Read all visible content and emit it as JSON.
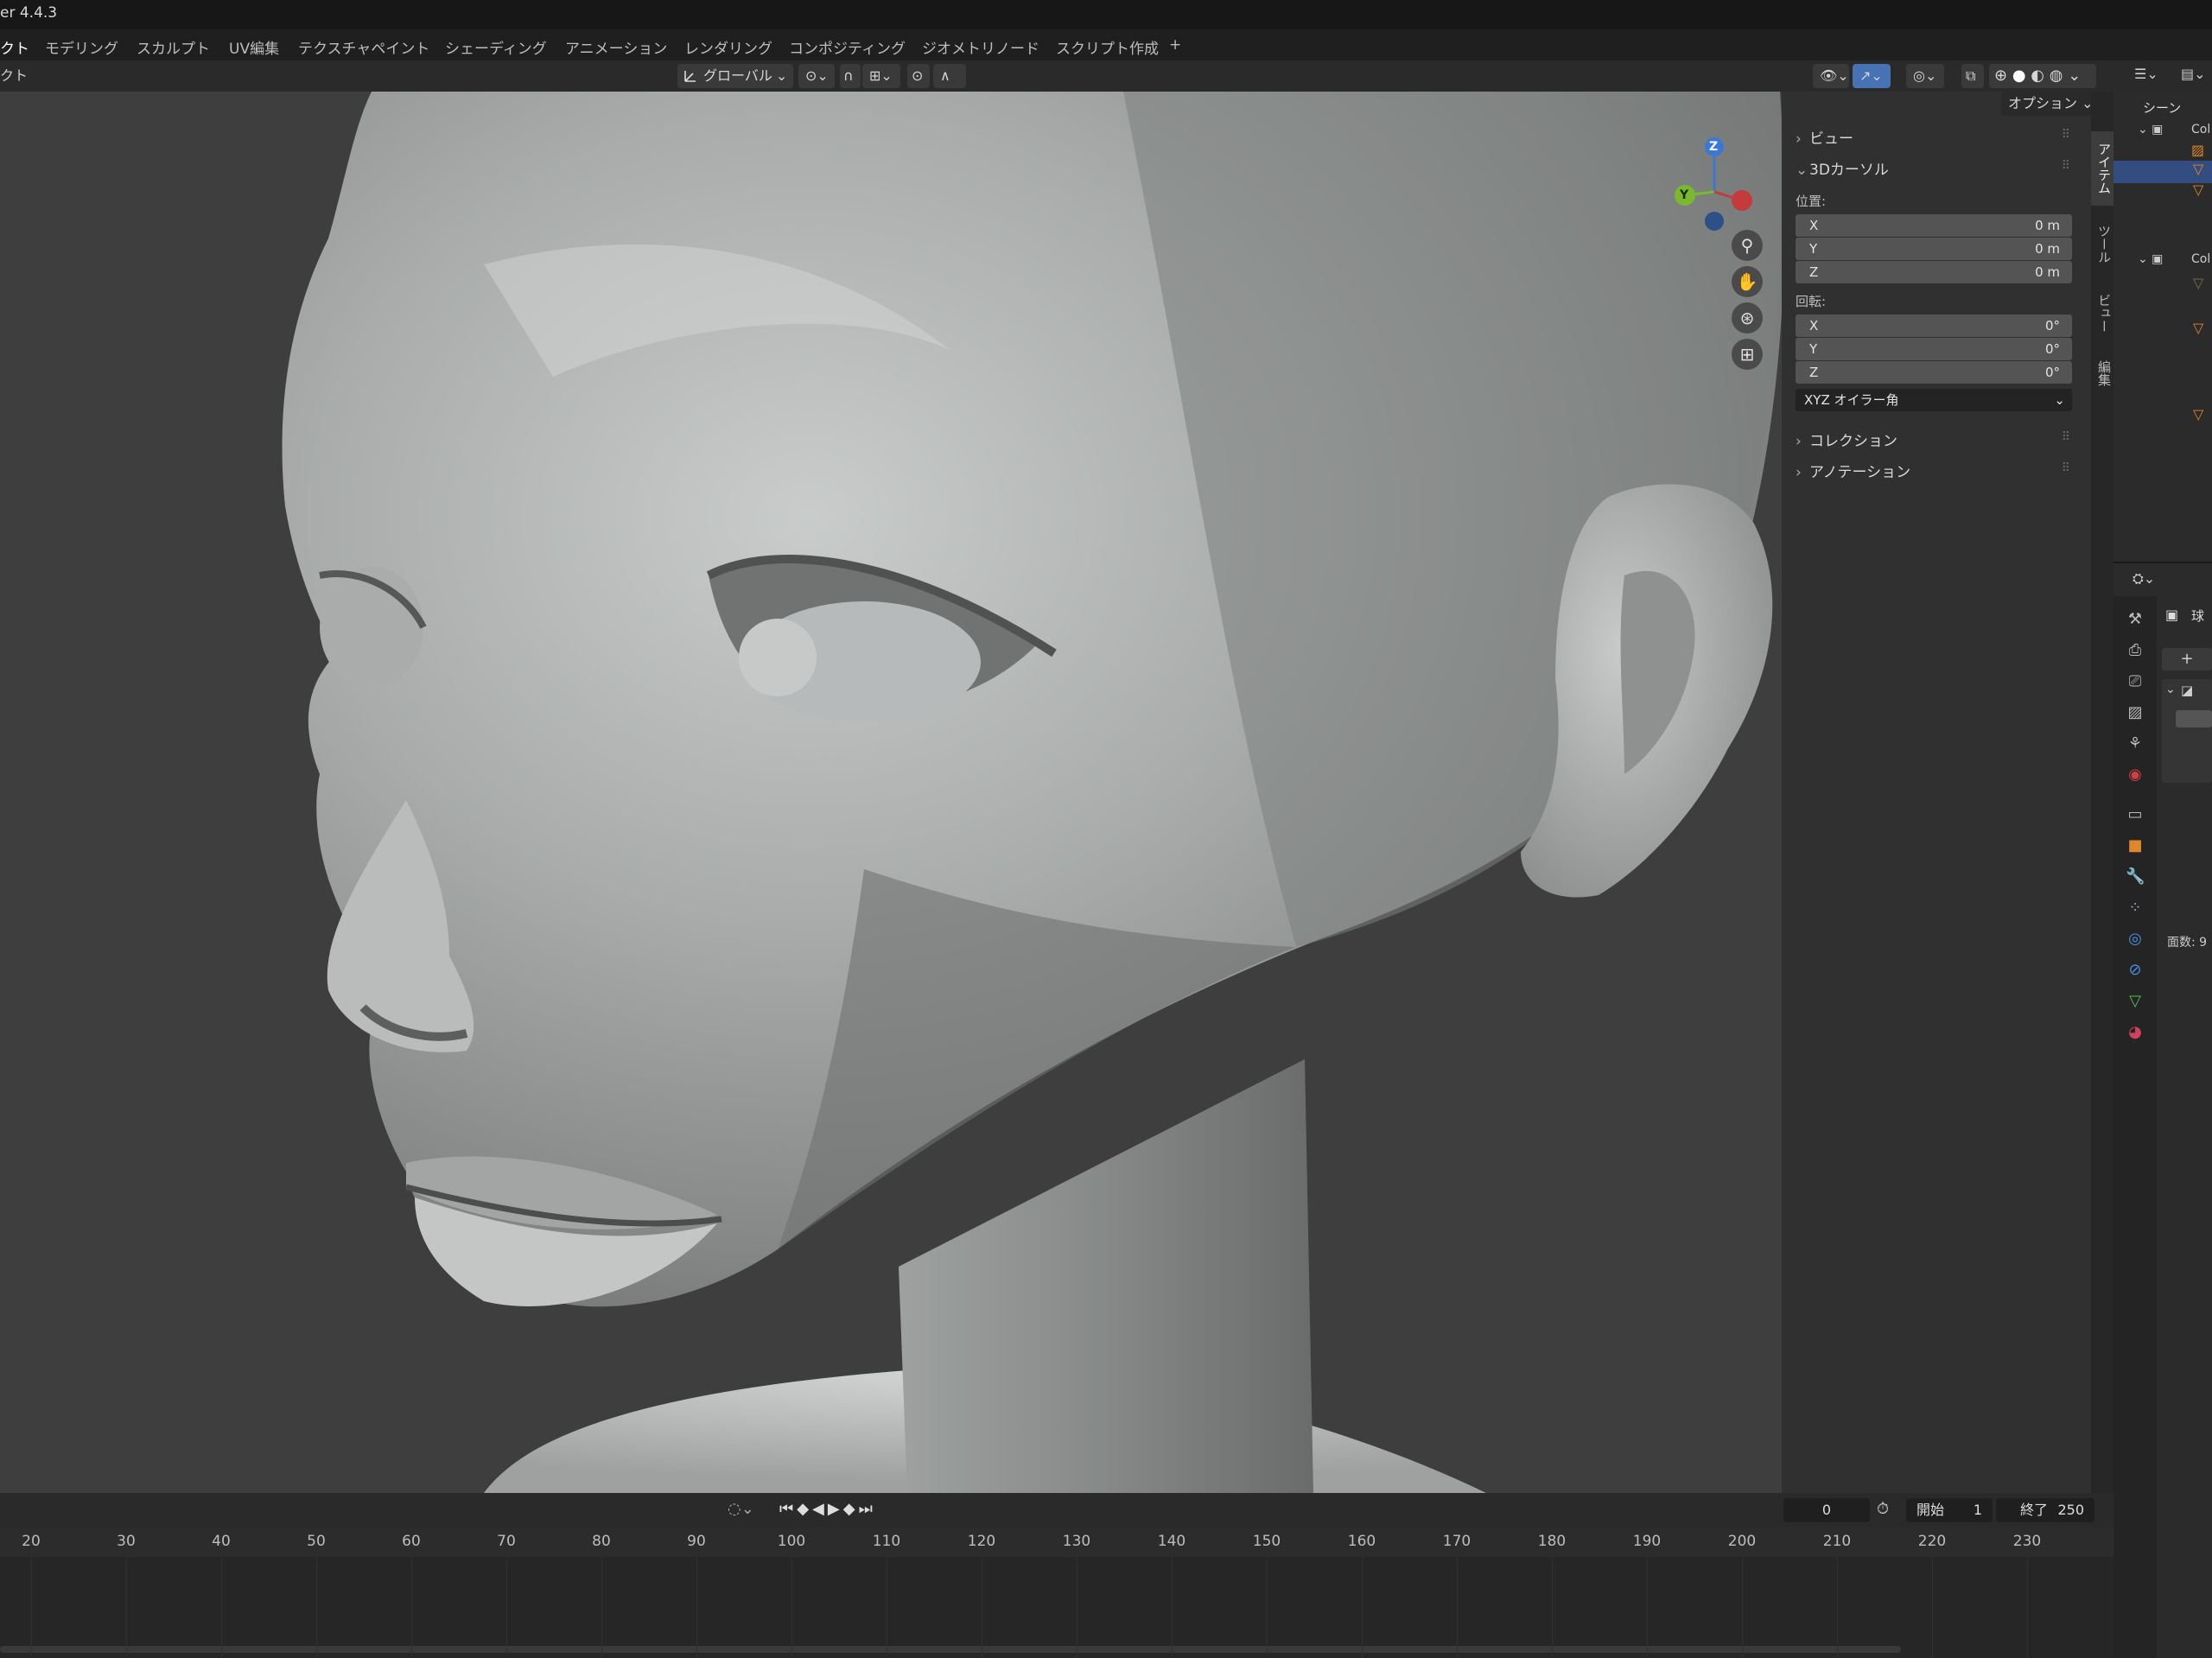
{
  "titlebar": {
    "title": "er 4.4.3"
  },
  "workspace_tabs": [
    "クト",
    "モデリング",
    "スカルプト",
    "UV編集",
    "テクスチャペイント",
    "シェーディング",
    "アニメーション",
    "レンダリング",
    "コンポジティング",
    "ジオメトリノード",
    "スクリプト作成",
    "+"
  ],
  "viewport_header": {
    "left_label": "クト",
    "transform_orientation": "グローバル",
    "options_label": "オプション"
  },
  "sidebar": {
    "tabs": [
      "アイテム",
      "ツール",
      "ビュー",
      "編集"
    ],
    "view_section": "ビュー",
    "cursor_section": "3Dカーソル",
    "location_label": "位置:",
    "location": [
      {
        "axis": "X",
        "value": "0 m"
      },
      {
        "axis": "Y",
        "value": "0 m"
      },
      {
        "axis": "Z",
        "value": "0 m"
      }
    ],
    "rotation_label": "回転:",
    "rotation": [
      {
        "axis": "X",
        "value": "0°"
      },
      {
        "axis": "Y",
        "value": "0°"
      },
      {
        "axis": "Z",
        "value": "0°"
      }
    ],
    "rotation_mode": "XYZ オイラー角",
    "collection_section": "コレクション",
    "annotation_section": "アノテーション"
  },
  "gizmo": {
    "z": "Z",
    "y": "Y"
  },
  "outliner": {
    "scene_label": "シーン",
    "collection_1": "Col",
    "collection_2": "Col"
  },
  "properties": {
    "object_label": "球",
    "count_label": "面数: 9"
  },
  "timeline": {
    "current_frame": "0",
    "start_label": "開始",
    "start_value": "1",
    "end_label": "終了",
    "end_value": "250",
    "ticks": [
      "20",
      "30",
      "40",
      "50",
      "60",
      "70",
      "80",
      "90",
      "100",
      "110",
      "120",
      "130",
      "140",
      "150",
      "160",
      "170",
      "180",
      "190",
      "200",
      "210",
      "220",
      "230"
    ]
  },
  "colors": {
    "accent": "#4772b3",
    "viewport_bg": "#3e3e3e",
    "gizmo_x": "#c33b3b",
    "gizmo_y": "#7ab92e",
    "gizmo_z": "#3a78d6",
    "object_orange": "#e0862c"
  }
}
